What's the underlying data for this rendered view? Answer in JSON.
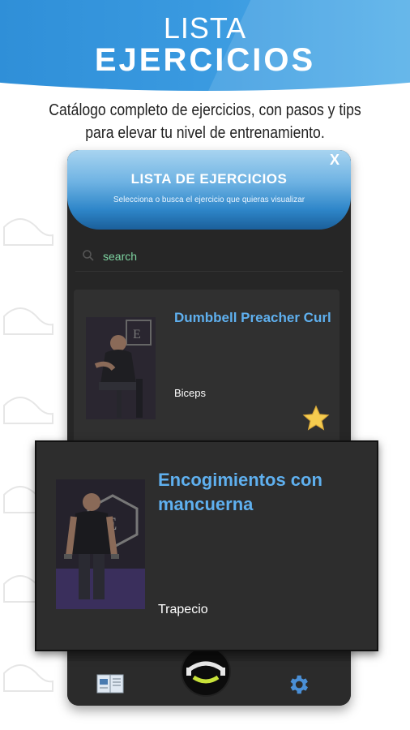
{
  "promo": {
    "title_line1": "LISTA",
    "title_line2": "EJERCICIOS",
    "tagline": "Catálogo completo de ejercicios, con pasos y tips para elevar tu nivel de entrenamiento."
  },
  "dialog": {
    "title": "LISTA DE EJERCICIOS",
    "subtitle": "Selecciona o busca el ejercicio que quieras visualizar",
    "close_label": "X"
  },
  "search": {
    "placeholder": "search",
    "value": ""
  },
  "exercises": [
    {
      "name": "Dumbbell Preacher Curl",
      "muscle": "Biceps",
      "favorite": true
    },
    {
      "name": "Encogimientos con mancuerna",
      "muscle": "Trapecio",
      "favorite": false
    }
  ],
  "nav": {
    "items": [
      "catalog-icon",
      "app-logo",
      "settings-icon"
    ]
  },
  "colors": {
    "accent": "#5fb0ef",
    "banner": "#3a9ae0",
    "search_text": "#7dd3a0",
    "star": "#f5cc4f"
  }
}
